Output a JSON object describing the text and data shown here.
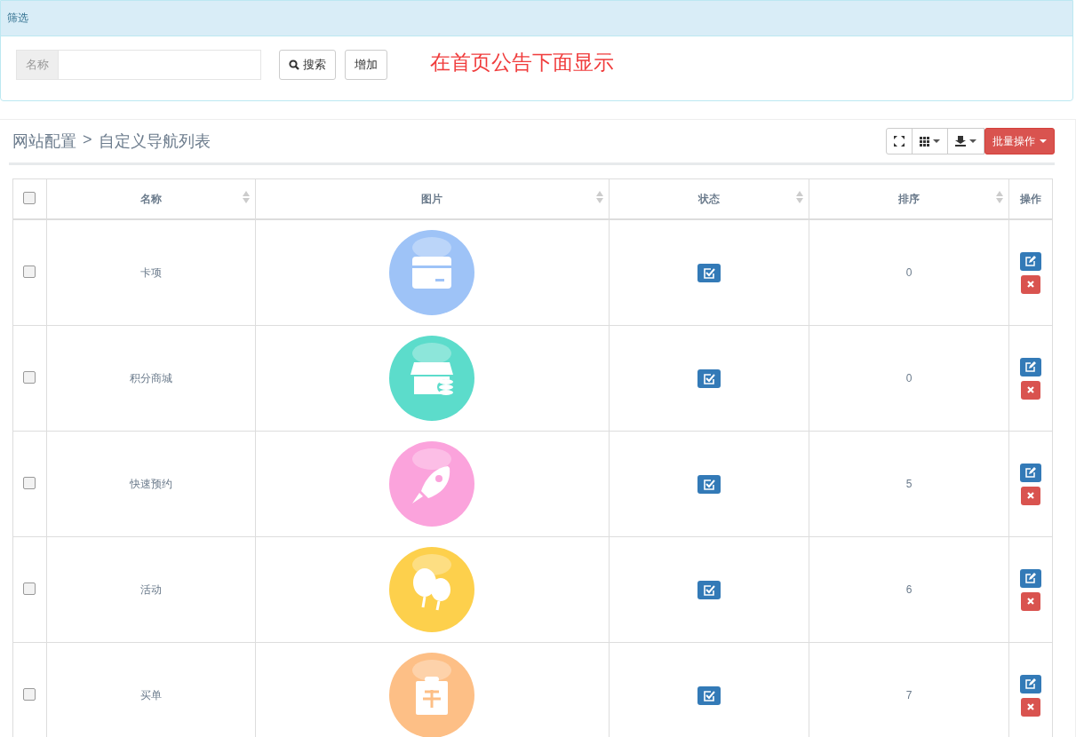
{
  "filter_panel": {
    "title": "筛选",
    "name_label": "名称",
    "search_button": "搜索",
    "add_button": "增加",
    "notice": "在首页公告下面显示"
  },
  "list_panel": {
    "breadcrumb": [
      "网站配置",
      ">",
      "自定义导航列表"
    ],
    "batch_button": "批量操作"
  },
  "table": {
    "select_all": {
      "checked": false
    },
    "columns": [
      {
        "label": "名称",
        "sortable": true
      },
      {
        "label": "图片",
        "sortable": true
      },
      {
        "label": "状态",
        "sortable": true
      },
      {
        "label": "排序",
        "sortable": true
      },
      {
        "label": "操作",
        "sortable": false
      }
    ],
    "rows": [
      {
        "checked": false,
        "name": "卡项",
        "image": {
          "kind": "card",
          "color": "#9ec3f7"
        },
        "status_on": true,
        "sort": "0"
      },
      {
        "checked": false,
        "name": "积分商城",
        "image": {
          "kind": "shop",
          "color": "#5cdccb"
        },
        "status_on": true,
        "sort": "0"
      },
      {
        "checked": false,
        "name": "快速预约",
        "image": {
          "kind": "rocket",
          "color": "#fba3dc"
        },
        "status_on": true,
        "sort": "5"
      },
      {
        "checked": false,
        "name": "活动",
        "image": {
          "kind": "balloon",
          "color": "#fdd04c"
        },
        "status_on": true,
        "sort": "6"
      },
      {
        "checked": false,
        "name": "买单",
        "image": {
          "kind": "clipboard",
          "color": "#fdbf86"
        },
        "status_on": true,
        "sort": "7"
      }
    ]
  }
}
